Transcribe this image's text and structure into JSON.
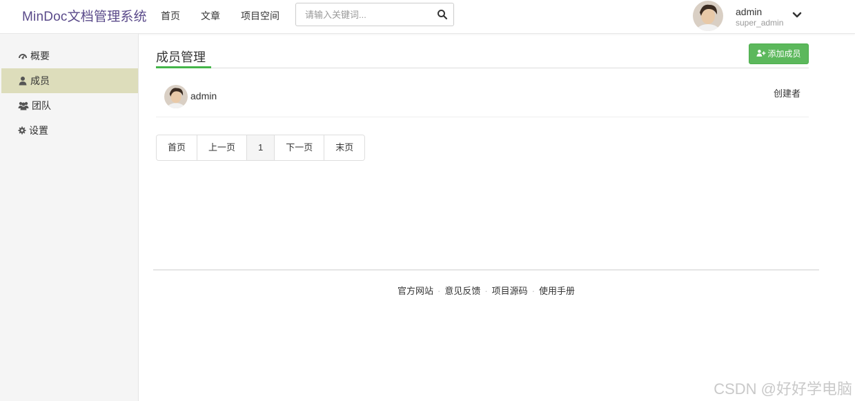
{
  "navbar": {
    "brand": "MinDoc文档管理系统",
    "links": [
      "首页",
      "文章",
      "项目空间"
    ],
    "search": {
      "placeholder": "请输入关键词..."
    },
    "user": {
      "name": "admin",
      "role": "super_admin"
    }
  },
  "sidebar": {
    "items": [
      {
        "label": "概要",
        "icon": "dashboard-icon",
        "active": false
      },
      {
        "label": "成员",
        "icon": "user-icon",
        "active": true
      },
      {
        "label": "团队",
        "icon": "users-icon",
        "active": false
      },
      {
        "label": "设置",
        "icon": "gear-icon",
        "active": false
      }
    ]
  },
  "main": {
    "title": "成员管理",
    "add_button": "添加成员",
    "members": [
      {
        "name": "admin",
        "role": "创建者"
      }
    ],
    "pagination": [
      "首页",
      "上一页",
      "1",
      "下一页",
      "末页"
    ],
    "current_page": "1"
  },
  "footer": {
    "links": [
      "官方网站",
      "意见反馈",
      "项目源码",
      "使用手册"
    ]
  },
  "watermark": "CSDN @好好学电脑",
  "colors": {
    "accent_green": "#5cb85c",
    "brand_purple": "#5a4a8a",
    "active_sidebar": "#ddddbb"
  }
}
